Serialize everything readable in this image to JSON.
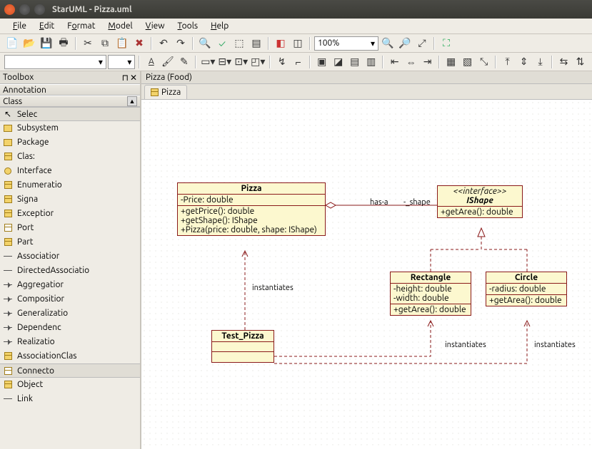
{
  "window": {
    "title": "StarUML - Pizza.uml"
  },
  "menu": [
    "File",
    "Edit",
    "Format",
    "Model",
    "View",
    "Tools",
    "Help"
  ],
  "zoom": "100%",
  "toolbox": {
    "title": "Toolbox",
    "sections": {
      "annotation": "Annotation",
      "class": "Class"
    },
    "items": [
      "Selec",
      "Subsystem",
      "Package",
      "Clas:",
      "Interface",
      "Enumeratio",
      "Signa",
      "Exceptior",
      "Port",
      "Part",
      "Associatior",
      "DirectedAssociatio",
      "Aggregatior",
      "Compositior",
      "Generalizatio",
      "Dependenc",
      "Realizatio",
      "AssociationClas",
      "Connecto",
      "Object",
      "Link"
    ],
    "selected": [
      0,
      18
    ]
  },
  "breadcrumb": "Pizza (Food)",
  "tab": {
    "label": "Pizza"
  },
  "diagram": {
    "Pizza": {
      "name": "Pizza",
      "attrs": [
        "-Price: double"
      ],
      "ops": [
        "+getPrice(): double",
        "+getShape(): IShape",
        "+Pizza(price: double, shape: IShape)"
      ]
    },
    "IShape": {
      "stereotype": "<<interface>>",
      "name": "IShape",
      "ops": [
        "+getArea(): double"
      ]
    },
    "Rectangle": {
      "name": "Rectangle",
      "attrs": [
        "-height: double",
        "-width: double"
      ],
      "ops": [
        "+getArea(): double"
      ]
    },
    "Circle": {
      "name": "Circle",
      "attrs": [
        "-radius: double"
      ],
      "ops": [
        "+getArea(): double"
      ]
    },
    "TestPizza": {
      "name": "Test_Pizza"
    },
    "labels": {
      "has_a": "has-a",
      "shape": "-_shape",
      "instantiates": "instantiates"
    }
  }
}
